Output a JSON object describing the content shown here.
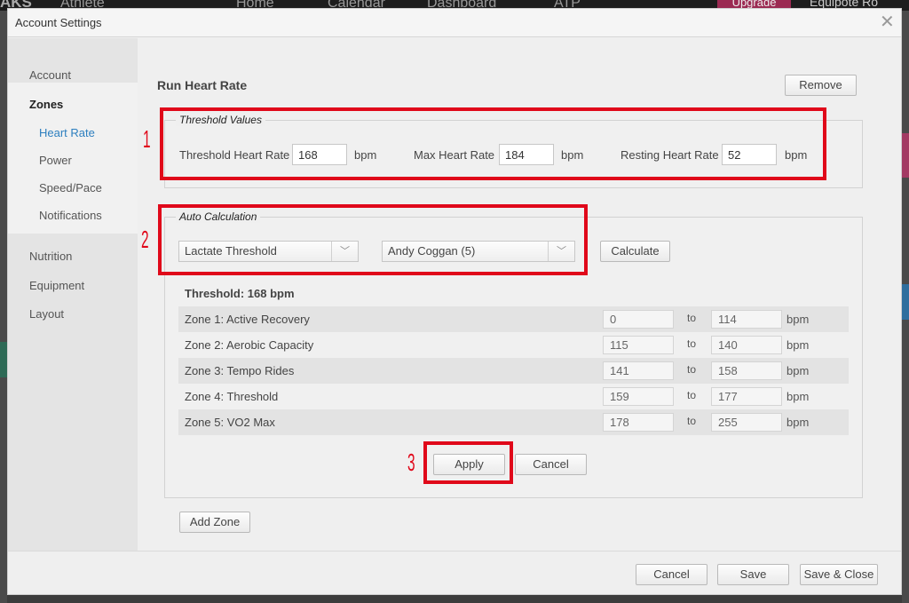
{
  "background": {
    "brand": "AKS",
    "nav": [
      "Athlete",
      "Home",
      "Calendar",
      "Dashboard",
      "ATP"
    ],
    "upgrade": "Upgrade",
    "user": "Equipote Ro"
  },
  "dialog": {
    "title": "Account Settings",
    "close_icon": "close-icon"
  },
  "sidebar": {
    "account": "Account",
    "zones": "Zones",
    "sub": [
      "Heart Rate",
      "Power",
      "Speed/Pace",
      "Notifications"
    ],
    "others": [
      "Nutrition",
      "Equipment",
      "Layout"
    ]
  },
  "main": {
    "title": "Run Heart Rate",
    "remove_label": "Remove",
    "threshold": {
      "legend": "Threshold Values",
      "threshold_hr_label": "Threshold Heart Rate",
      "threshold_hr_value": "168",
      "max_hr_label": "Max Heart Rate",
      "max_hr_value": "184",
      "resting_hr_label": "Resting Heart Rate",
      "resting_hr_value": "52",
      "unit": "bpm"
    },
    "auto": {
      "legend": "Auto Calculation",
      "method": "Lactate Threshold",
      "model": "Andy Coggan (5)",
      "calculate_label": "Calculate",
      "result": "Threshold: 168 bpm",
      "zones": [
        {
          "name": "Zone 1: Active Recovery",
          "from": "0",
          "to": "114"
        },
        {
          "name": "Zone 2: Aerobic Capacity",
          "from": "115",
          "to": "140"
        },
        {
          "name": "Zone 3: Tempo Rides",
          "from": "141",
          "to": "158"
        },
        {
          "name": "Zone 4: Threshold",
          "from": "159",
          "to": "177"
        },
        {
          "name": "Zone 5: VO2 Max",
          "from": "178",
          "to": "255"
        }
      ],
      "to_label": "to",
      "unit": "bpm",
      "apply_label": "Apply",
      "cancel_label": "Cancel"
    },
    "add_zone_label": "Add Zone"
  },
  "footer": {
    "cancel_label": "Cancel",
    "save_label": "Save",
    "save_close_label": "Save & Close"
  },
  "annotations": {
    "marker_1": "1",
    "marker_2": "2",
    "marker_3": "3",
    "color": "#e0081a"
  }
}
